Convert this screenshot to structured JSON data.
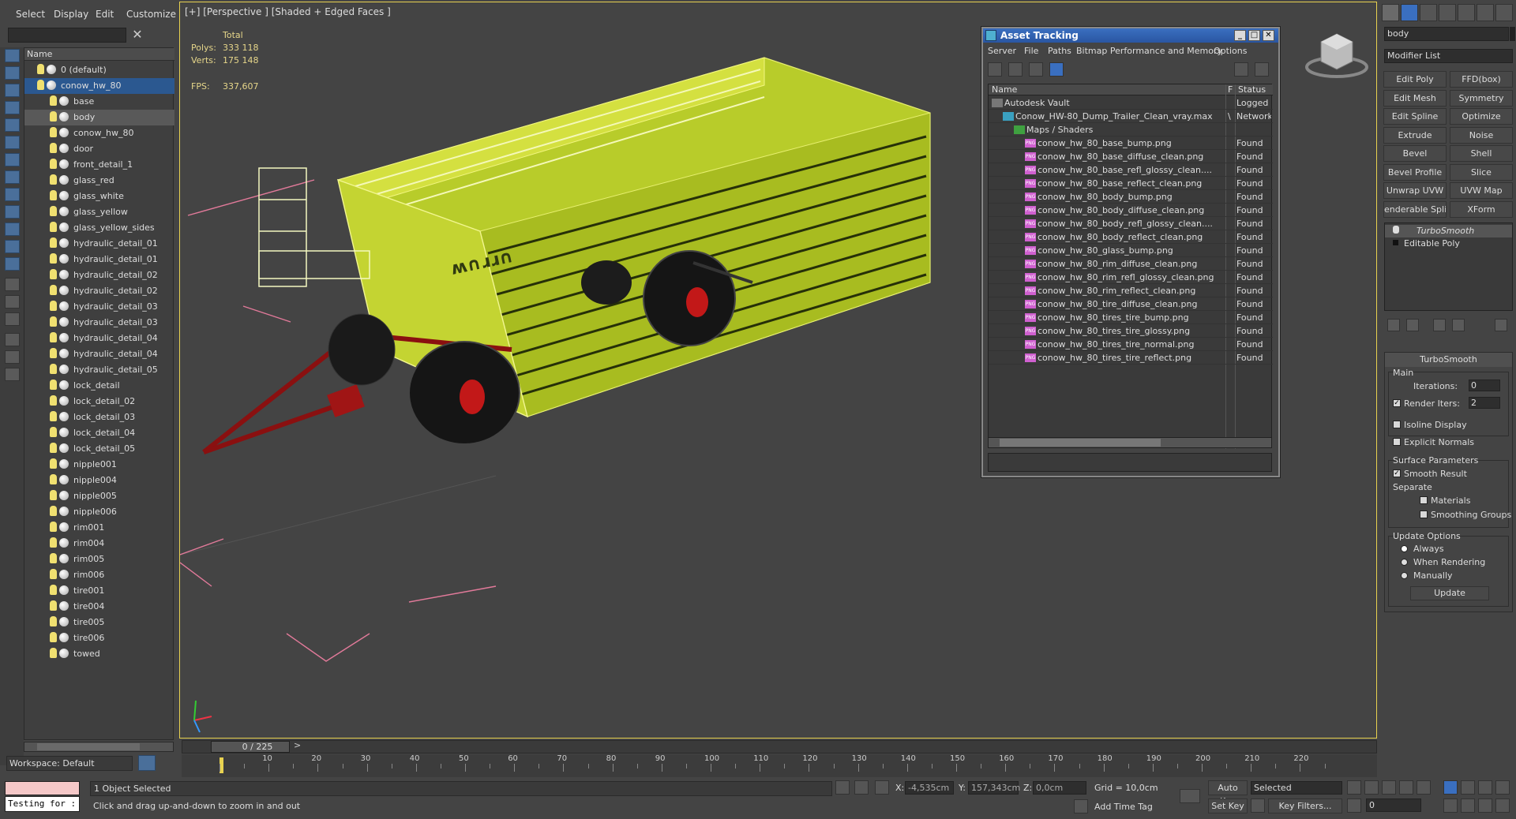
{
  "menu": {
    "select": "Select",
    "display": "Display",
    "edit": "Edit",
    "customize": "Customize"
  },
  "explorer": {
    "column_name": "Name",
    "workspace": "Workspace: Default",
    "items": [
      {
        "label": "0 (default)",
        "level": 0
      },
      {
        "label": "conow_hw_80",
        "level": 0,
        "selected": true
      },
      {
        "label": "base",
        "level": 1
      },
      {
        "label": "body",
        "level": 1,
        "highlighted": true
      },
      {
        "label": "conow_hw_80",
        "level": 1
      },
      {
        "label": "door",
        "level": 1
      },
      {
        "label": "front_detail_1",
        "level": 1
      },
      {
        "label": "glass_red",
        "level": 1
      },
      {
        "label": "glass_white",
        "level": 1
      },
      {
        "label": "glass_yellow",
        "level": 1
      },
      {
        "label": "glass_yellow_sides",
        "level": 1
      },
      {
        "label": "hydraulic_detail_01",
        "level": 1
      },
      {
        "label": "hydraulic_detail_01",
        "level": 1
      },
      {
        "label": "hydraulic_detail_02",
        "level": 1
      },
      {
        "label": "hydraulic_detail_02",
        "level": 1
      },
      {
        "label": "hydraulic_detail_03",
        "level": 1
      },
      {
        "label": "hydraulic_detail_03",
        "level": 1
      },
      {
        "label": "hydraulic_detail_04",
        "level": 1
      },
      {
        "label": "hydraulic_detail_04",
        "level": 1
      },
      {
        "label": "hydraulic_detail_05",
        "level": 1
      },
      {
        "label": "lock_detail",
        "level": 1
      },
      {
        "label": "lock_detail_02",
        "level": 1
      },
      {
        "label": "lock_detail_03",
        "level": 1
      },
      {
        "label": "lock_detail_04",
        "level": 1
      },
      {
        "label": "lock_detail_05",
        "level": 1
      },
      {
        "label": "nipple001",
        "level": 1
      },
      {
        "label": "nipple004",
        "level": 1
      },
      {
        "label": "nipple005",
        "level": 1
      },
      {
        "label": "nipple006",
        "level": 1
      },
      {
        "label": "rim001",
        "level": 1
      },
      {
        "label": "rim004",
        "level": 1
      },
      {
        "label": "rim005",
        "level": 1
      },
      {
        "label": "rim006",
        "level": 1
      },
      {
        "label": "tire001",
        "level": 1
      },
      {
        "label": "tire004",
        "level": 1
      },
      {
        "label": "tire005",
        "level": 1
      },
      {
        "label": "tire006",
        "level": 1
      },
      {
        "label": "towed",
        "level": 1
      }
    ]
  },
  "viewport": {
    "label": "[+] [Perspective ] [Shaded + Edged Faces ]",
    "stats": {
      "total": "Total",
      "polys_label": "Polys:",
      "polys": "333 118",
      "verts_label": "Verts:",
      "verts": "175 148",
      "fps_label": "FPS:",
      "fps": "337,607"
    }
  },
  "asset_tracking": {
    "title": "Asset Tracking",
    "menu": [
      "Server",
      "File",
      "Paths",
      "Bitmap Performance and Memory",
      "Options"
    ],
    "col_name": "Name",
    "col_f": "F",
    "col_status": "Status",
    "rows": [
      {
        "name": "Autodesk Vault",
        "status": "Logged O",
        "indent": 0,
        "type": "vault"
      },
      {
        "name": "Conow_HW-80_Dump_Trailer_Clean_vray.max",
        "status": "Network",
        "indent": 1,
        "type": "max",
        "f": "\\"
      },
      {
        "name": "Maps / Shaders",
        "status": "",
        "indent": 2,
        "type": "folder"
      },
      {
        "name": "conow_hw_80_base_bump.png",
        "status": "Found",
        "indent": 3,
        "type": "png"
      },
      {
        "name": "conow_hw_80_base_diffuse_clean.png",
        "status": "Found",
        "indent": 3,
        "type": "png"
      },
      {
        "name": "conow_hw_80_base_refl_glossy_clean....",
        "status": "Found",
        "indent": 3,
        "type": "png"
      },
      {
        "name": "conow_hw_80_base_reflect_clean.png",
        "status": "Found",
        "indent": 3,
        "type": "png"
      },
      {
        "name": "conow_hw_80_body_bump.png",
        "status": "Found",
        "indent": 3,
        "type": "png"
      },
      {
        "name": "conow_hw_80_body_diffuse_clean.png",
        "status": "Found",
        "indent": 3,
        "type": "png"
      },
      {
        "name": "conow_hw_80_body_refl_glossy_clean....",
        "status": "Found",
        "indent": 3,
        "type": "png"
      },
      {
        "name": "conow_hw_80_body_reflect_clean.png",
        "status": "Found",
        "indent": 3,
        "type": "png"
      },
      {
        "name": "conow_hw_80_glass_bump.png",
        "status": "Found",
        "indent": 3,
        "type": "png"
      },
      {
        "name": "conow_hw_80_rim_diffuse_clean.png",
        "status": "Found",
        "indent": 3,
        "type": "png"
      },
      {
        "name": "conow_hw_80_rim_refl_glossy_clean.png",
        "status": "Found",
        "indent": 3,
        "type": "png"
      },
      {
        "name": "conow_hw_80_rim_reflect_clean.png",
        "status": "Found",
        "indent": 3,
        "type": "png"
      },
      {
        "name": "conow_hw_80_tire_diffuse_clean.png",
        "status": "Found",
        "indent": 3,
        "type": "png"
      },
      {
        "name": "conow_hw_80_tires_tire_bump.png",
        "status": "Found",
        "indent": 3,
        "type": "png"
      },
      {
        "name": "conow_hw_80_tires_tire_glossy.png",
        "status": "Found",
        "indent": 3,
        "type": "png"
      },
      {
        "name": "conow_hw_80_tires_tire_normal.png",
        "status": "Found",
        "indent": 3,
        "type": "png"
      },
      {
        "name": "conow_hw_80_tires_tire_reflect.png",
        "status": "Found",
        "indent": 3,
        "type": "png"
      }
    ]
  },
  "command_panel": {
    "object_name": "body",
    "modifier_list": "Modifier List",
    "buttons": [
      "Edit Poly",
      "FFD(box)",
      "Edit Mesh",
      "Symmetry",
      "Edit Spline",
      "Optimize",
      "Extrude",
      "Noise",
      "Bevel",
      "Shell",
      "Bevel Profile",
      "Slice",
      "Unwrap UVW",
      "UVW Map",
      "enderable Splin",
      "XForm"
    ],
    "stack": [
      "TurboSmooth",
      "Editable Poly"
    ],
    "turbosmooth": {
      "title": "TurboSmooth",
      "main": "Main",
      "iterations_label": "Iterations:",
      "iterations": "0",
      "render_iters_label": "Render Iters:",
      "render_iters": "2",
      "isoline": "Isoline Display",
      "explicit": "Explicit Normals",
      "surface": "Surface Parameters",
      "smooth_result": "Smooth Result",
      "separate": "Separate",
      "materials": "Materials",
      "smoothing_groups": "Smoothing Groups",
      "update_options": "Update Options",
      "always": "Always",
      "when_rendering": "When Rendering",
      "manually": "Manually",
      "update": "Update"
    }
  },
  "timeline": {
    "slider": "0 / 225",
    "ticks": [
      "10",
      "20",
      "30",
      "40",
      "50",
      "60",
      "70",
      "80",
      "90",
      "100",
      "110",
      "120",
      "130",
      "140",
      "150",
      "160",
      "170",
      "180",
      "190",
      "200",
      "210",
      "220"
    ]
  },
  "statusbar": {
    "maxscript": "Testing for :",
    "selected": "1 Object Selected",
    "prompt": "Click and drag up-and-down to zoom in and out",
    "x_label": "X:",
    "x": "-4,535cm",
    "y_label": "Y:",
    "y": "157,343cm",
    "z_label": "Z:",
    "z": "0,0cm",
    "grid": "Grid = 10,0cm",
    "add_time_tag": "Add Time Tag",
    "auto_key": "Auto Key",
    "set_key": "Set Key",
    "selected_dropdown": "Selected",
    "key_filters": "Key Filters...",
    "frame": "0"
  }
}
